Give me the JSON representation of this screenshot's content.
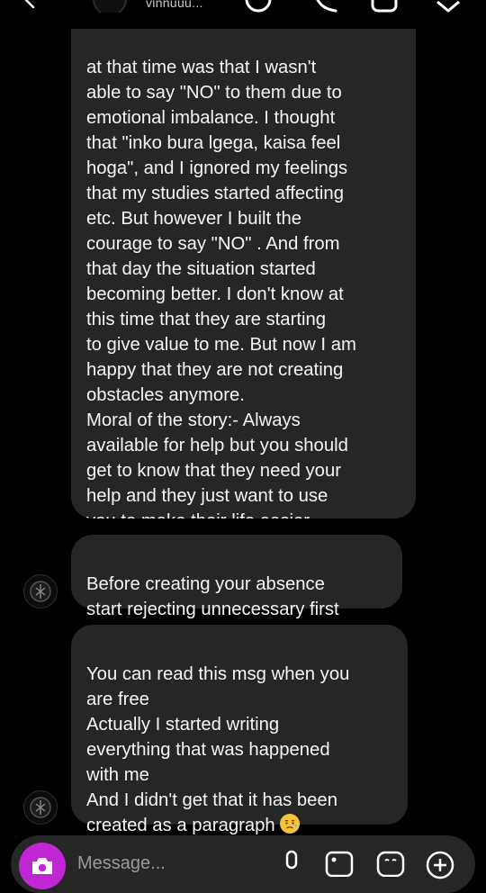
{
  "header": {
    "username": "vinnuuu...",
    "icons": [
      "back-arrow-icon",
      "call-icon",
      "phone-icon",
      "video-icon",
      "flag-icon"
    ]
  },
  "messages": [
    {
      "id": "msg-1",
      "text": "at that time was that I wasn't\nable to say \"NO\" to them due to\nemotional imbalance. I thought\nthat \"inko bura lgega, kaisa feel\nhoga\", and I ignored my feelings\nthat my studies started affecting\netc. But however I built the\ncourage to say \"NO\" . And from\nthat day the situation started\nbecoming better. I don't know at\nthis time that they are starting\nto give value to me. But now I am\nhappy that they are not creating\nobstacles anymore.\nMoral of the story:- Always\navailable for help but you should\nget to know that they need your\nhelp and they just want to use\nyou to make their life easier."
    },
    {
      "id": "msg-2",
      "text": "Before creating your absence\nstart rejecting unnecessary first"
    },
    {
      "id": "msg-3",
      "text": "You can read this msg when you\nare free\nActually I started writing\neverything that was happened\nwith me\nAnd I didn't get that it has been\ncreated as a paragraph",
      "emoji": "😥"
    }
  ],
  "composer": {
    "placeholder": "Message...",
    "icons": [
      "camera-icon",
      "microphone-icon",
      "gallery-icon",
      "sticker-icon",
      "plus-icon"
    ]
  },
  "colors": {
    "background": "#000000",
    "bubble": "#262626",
    "text": "#f5f5f5",
    "camera_button": "#c026d3"
  }
}
